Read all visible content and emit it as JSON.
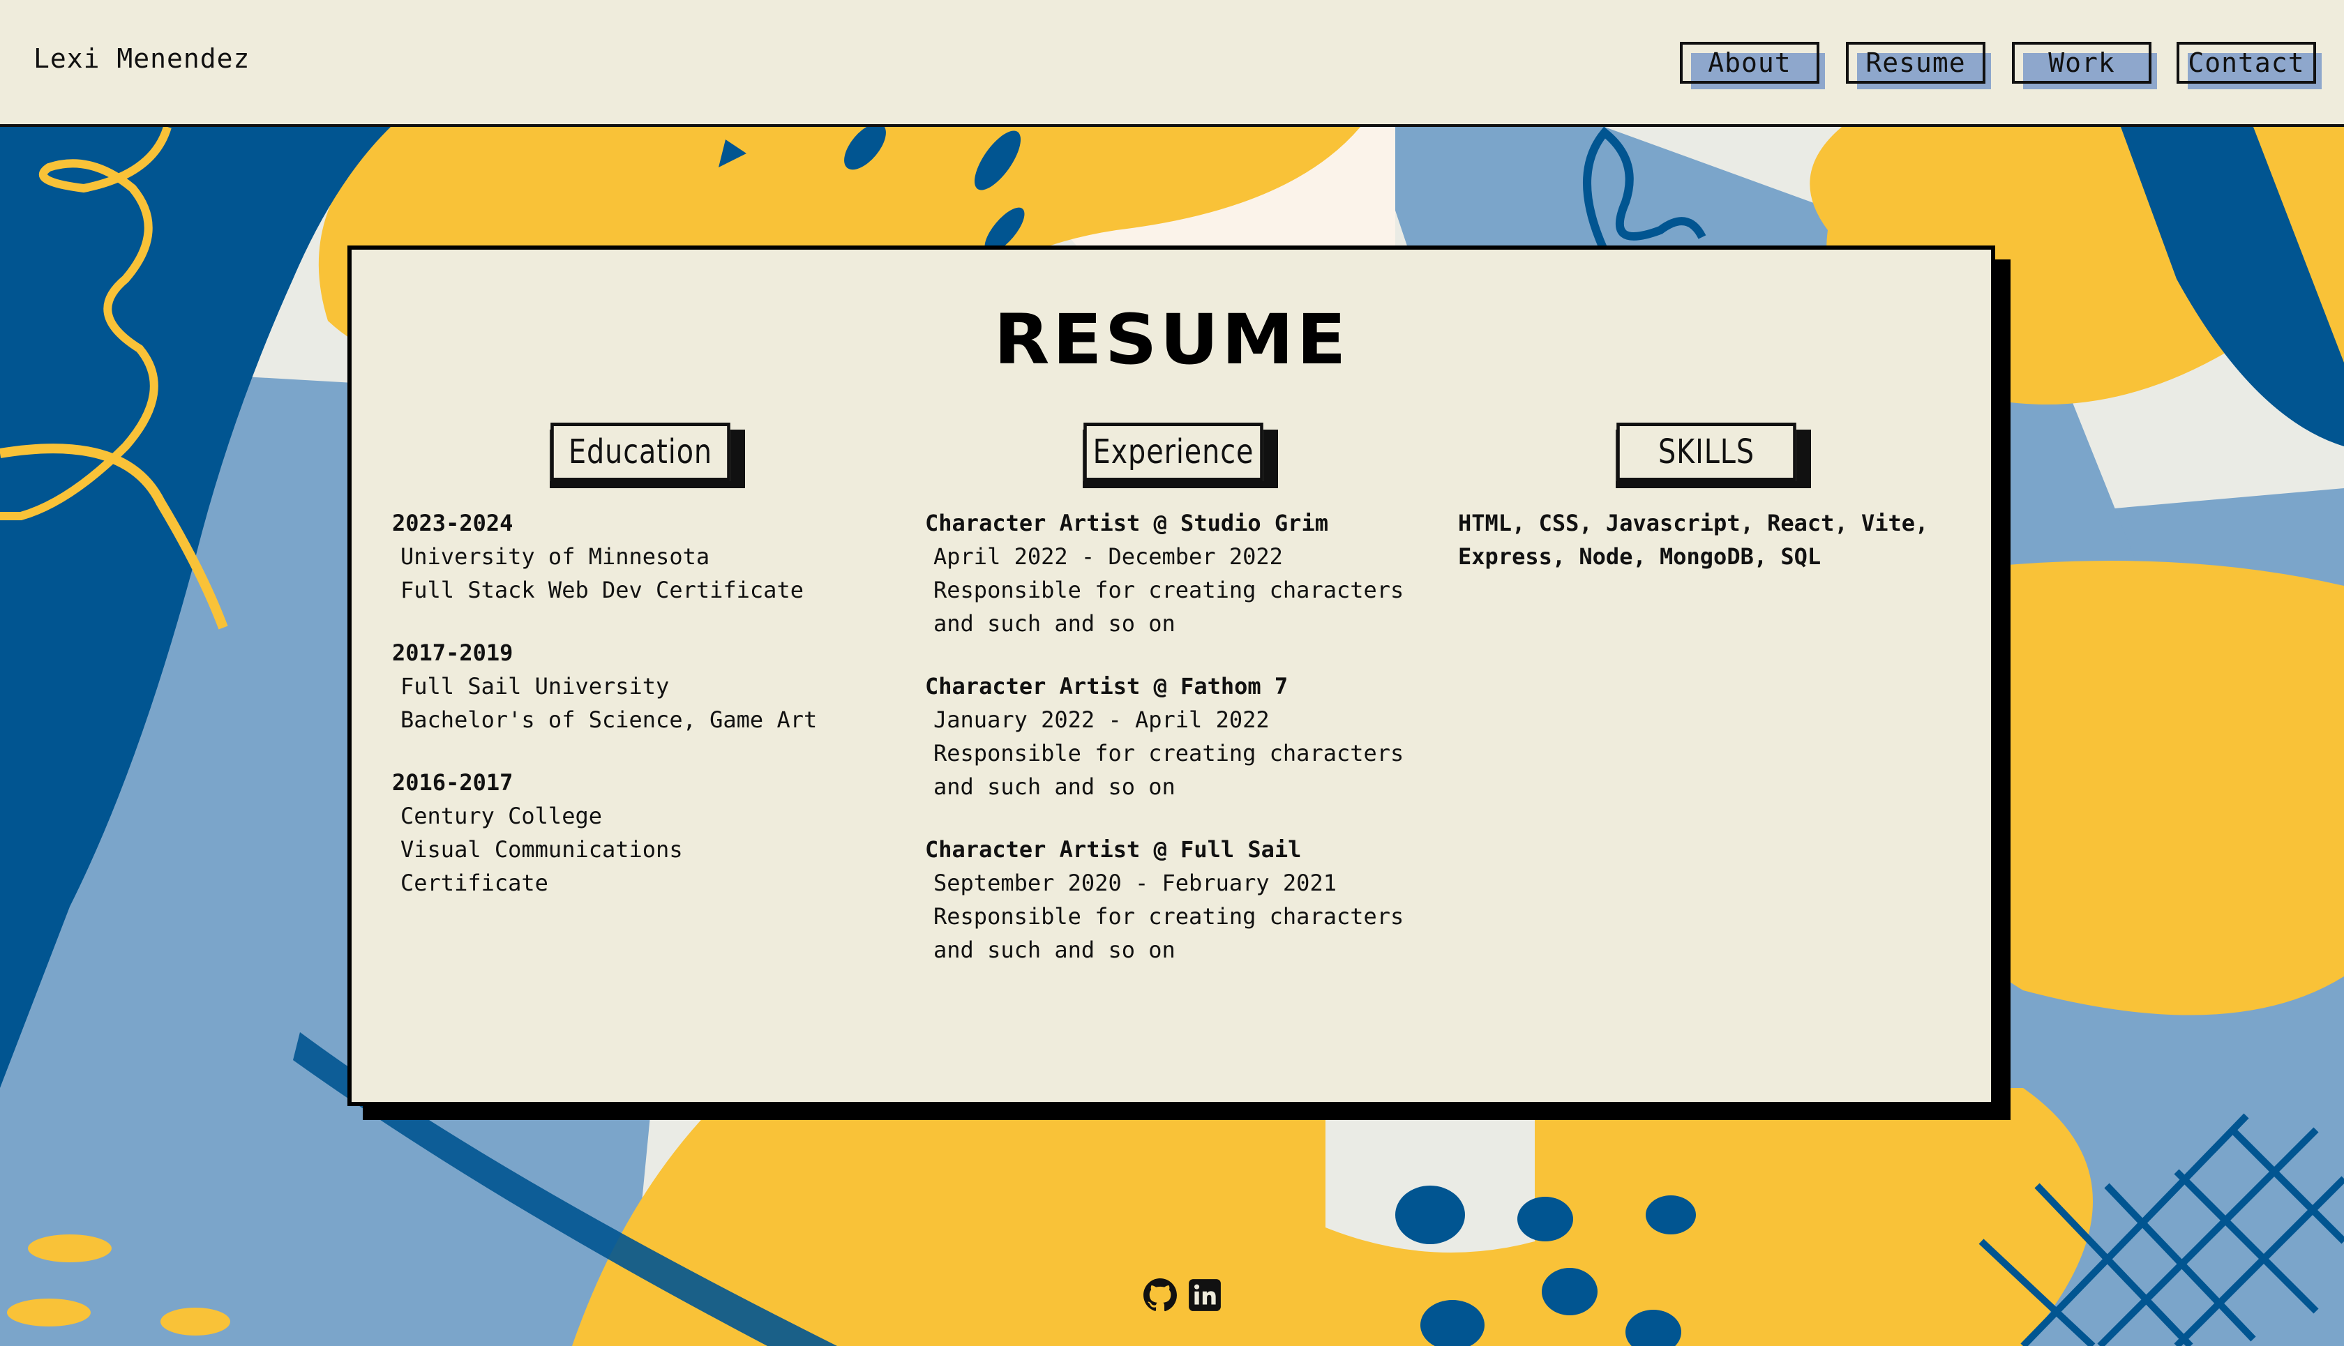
{
  "header": {
    "brand": "Lexi Menendez",
    "nav": [
      "About",
      "Resume",
      "Work",
      "Contact"
    ]
  },
  "resume": {
    "title": "RESUME",
    "education": {
      "heading": "Education",
      "entries": [
        {
          "years": "2023-2024",
          "school": "University of Minnesota",
          "detail": "Full Stack Web Dev Certificate"
        },
        {
          "years": "2017-2019",
          "school": "Full Sail University",
          "detail": "Bachelor's of Science, Game Art"
        },
        {
          "years": "2016-2017",
          "school": "Century College",
          "detail": "Visual Communications Certificate"
        }
      ]
    },
    "experience": {
      "heading": "Experience",
      "entries": [
        {
          "role": "Character Artist @ Studio Grim",
          "dates": "April 2022 - December 2022",
          "desc1": "Responsible for creating characters",
          "desc2": "and such and so on"
        },
        {
          "role": "Character Artist @ Fathom 7",
          "dates": "January 2022 - April 2022",
          "desc1": "Responsible for creating characters",
          "desc2": "and such and so on"
        },
        {
          "role": "Character Artist @ Full Sail",
          "dates": "September 2020 - February 2021",
          "desc1": "Responsible for creating characters",
          "desc2": "and such and so on"
        }
      ]
    },
    "skills": {
      "heading": "SKILLS",
      "line1": "HTML, CSS, Javascript, React, Vite,",
      "line2": "Express, Node, MongoDB, SQL"
    }
  },
  "footer": {
    "icons": [
      "github-icon",
      "linkedin-icon"
    ]
  },
  "colors": {
    "background": "#efecdc",
    "accent_yellow": "#f9c238",
    "accent_navy": "#015591",
    "accent_blue": "#7ba5ca",
    "nav_shadow": "#8ea7cc"
  }
}
